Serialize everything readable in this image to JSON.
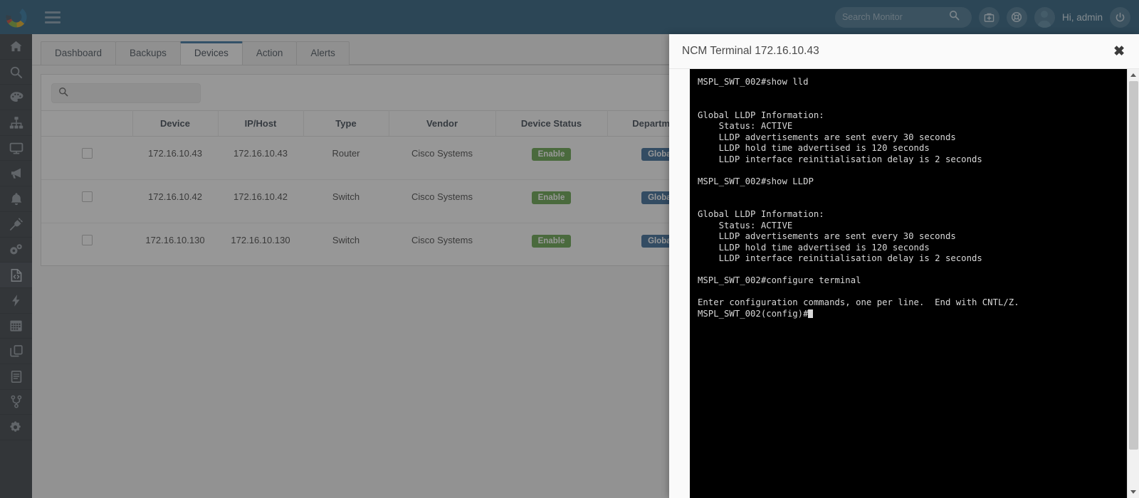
{
  "topbar": {
    "logo_name": "donut-logo",
    "menu_toggle": "menu-toggle",
    "search": {
      "placeholder": "Search Monitor",
      "value": ""
    },
    "greeting": "Hi, admin",
    "icons": [
      "search-icon",
      "first-aid-kit-icon",
      "lifebuoy-support-icon",
      "avatar-icon",
      "power-icon"
    ],
    "accent_color": "#1d5273"
  },
  "sidebar": {
    "items": [
      {
        "icon": "home-icon",
        "active": false
      },
      {
        "icon": "search-icon",
        "active": false
      },
      {
        "icon": "palette-icon",
        "active": false
      },
      {
        "icon": "network-topology-icon",
        "active": false
      },
      {
        "icon": "monitor-icon",
        "active": false
      },
      {
        "icon": "megaphone-icon",
        "active": false
      },
      {
        "icon": "bell-icon",
        "active": false
      },
      {
        "icon": "plug-icon",
        "active": false
      },
      {
        "icon": "gears-icon",
        "active": false
      },
      {
        "icon": "document-code-icon",
        "active": true
      },
      {
        "icon": "lightning-bolt-icon",
        "active": false
      },
      {
        "icon": "calendar-icon",
        "active": false
      },
      {
        "icon": "copy-layers-icon",
        "active": false
      },
      {
        "icon": "file-lines-icon",
        "active": false
      },
      {
        "icon": "branch-icon",
        "active": false
      },
      {
        "icon": "gear-icon",
        "active": false
      }
    ]
  },
  "tabs": [
    {
      "label": "Dashboard",
      "active": false
    },
    {
      "label": "Backups",
      "active": false
    },
    {
      "label": "Devices",
      "active": true
    },
    {
      "label": "Action",
      "active": false
    },
    {
      "label": "Alerts",
      "active": false
    }
  ],
  "table_search": {
    "placeholder": "",
    "value": ""
  },
  "table": {
    "columns": [
      "",
      "Device",
      "IP/Host",
      "Type",
      "Vendor",
      "Device Status",
      "Departments",
      ""
    ],
    "rows": [
      {
        "device": "172.16.10.43",
        "ip_host": "172.16.10.43",
        "type": "Router",
        "vendor": "Cisco Systems",
        "status": "Enable",
        "department": "Global"
      },
      {
        "device": "172.16.10.42",
        "ip_host": "172.16.10.42",
        "type": "Switch",
        "vendor": "Cisco Systems",
        "status": "Enable",
        "department": "Global"
      },
      {
        "device": "172.16.10.130",
        "ip_host": "172.16.10.130",
        "type": "Switch",
        "vendor": "Cisco Systems",
        "status": "Enable",
        "department": "Global"
      }
    ],
    "status_color": "#5a9e3f",
    "department_color": "#2a5f8f"
  },
  "modal": {
    "title": "NCM Terminal 172.16.10.43",
    "close_label": "✖",
    "terminal_text": "MSPL_SWT_002#show lld\n\n\nGlobal LLDP Information:\n    Status: ACTIVE\n    LLDP advertisements are sent every 30 seconds\n    LLDP hold time advertised is 120 seconds\n    LLDP interface reinitialisation delay is 2 seconds\n\nMSPL_SWT_002#show LLDP\n\n\nGlobal LLDP Information:\n    Status: ACTIVE\n    LLDP advertisements are sent every 30 seconds\n    LLDP hold time advertised is 120 seconds\n    LLDP interface reinitialisation delay is 2 seconds\n\nMSPL_SWT_002#configure terminal\n\nEnter configuration commands, one per line.  End with CNTL/Z.\nMSPL_SWT_002(config)#"
  }
}
